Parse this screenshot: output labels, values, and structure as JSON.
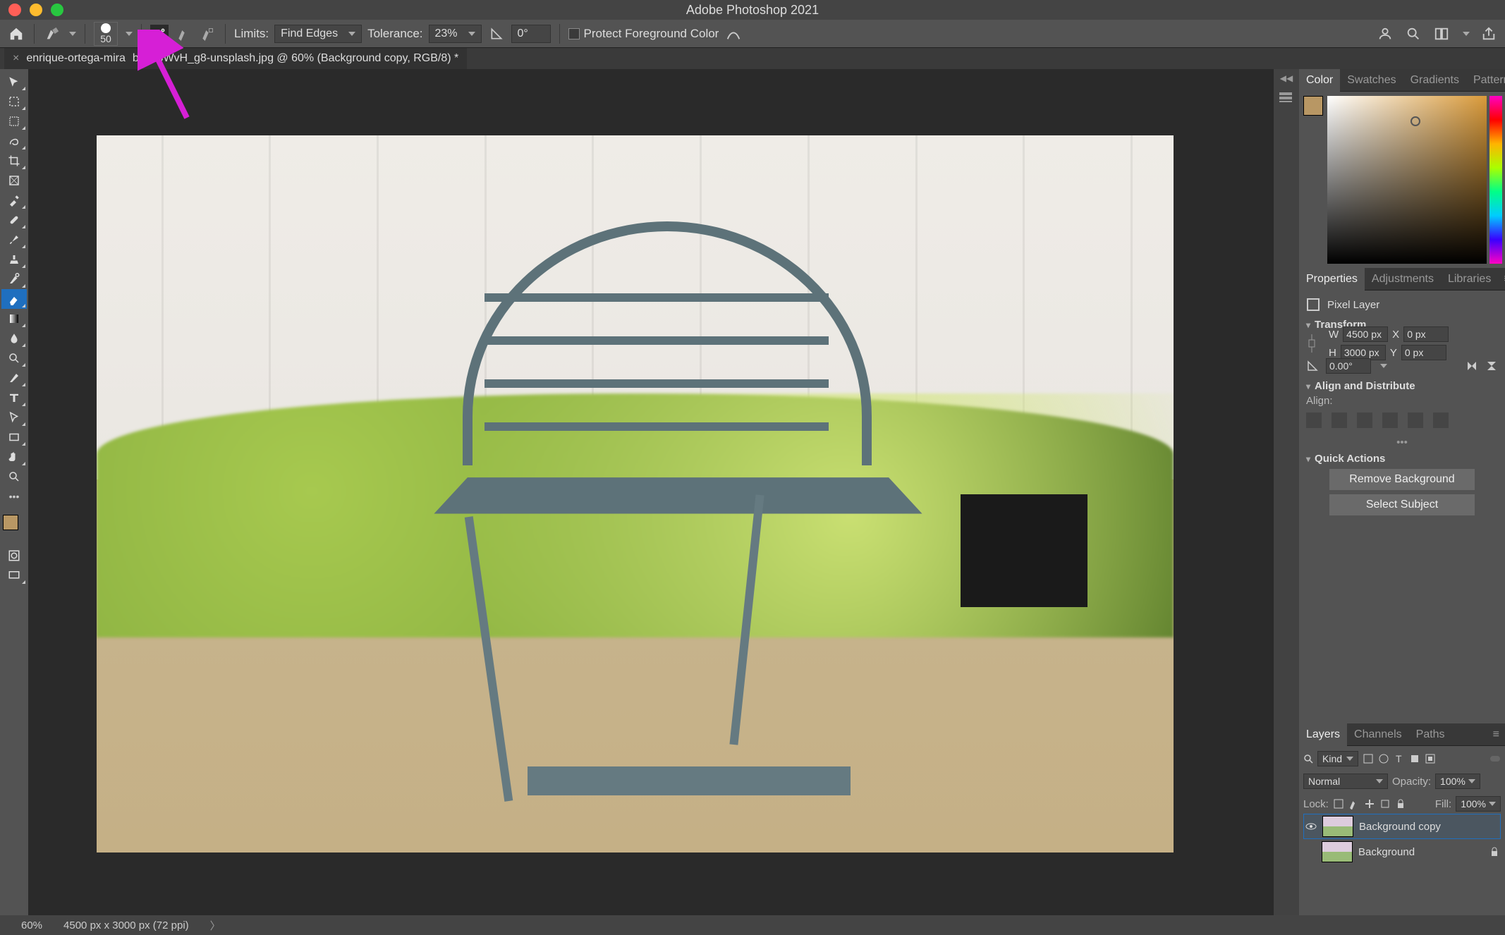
{
  "titlebar": {
    "app_title": "Adobe Photoshop 2021"
  },
  "optbar": {
    "brush_size": "50",
    "limits_label": "Limits:",
    "limits_value": "Find Edges",
    "tolerance_label": "Tolerance:",
    "tolerance_value": "23%",
    "angle_value": "0°",
    "protect_label": "Protect Foreground Color"
  },
  "doctab": {
    "filename": "enrique-ortega-mira",
    "suffix": "b3xo3WvH_g8-unsplash.jpg @ 60% (Background copy, RGB/8) *"
  },
  "toolbar": {
    "tools": [
      "move-tool",
      "artboard-tool",
      "marquee-tool",
      "lasso-tool",
      "crop-tool",
      "frame-tool",
      "eyedropper-tool",
      "spot-heal-tool",
      "brush-tool",
      "clone-stamp-tool",
      "history-brush-tool",
      "background-eraser-tool",
      "gradient-tool",
      "blur-tool",
      "dodge-tool",
      "pen-tool",
      "type-tool",
      "path-select-tool",
      "rectangle-tool",
      "hand-tool",
      "zoom-tool",
      "edit-toolbar"
    ],
    "fg_color": "#b89764",
    "bg_color": "#ffffff"
  },
  "panels": {
    "color_tabs": [
      "Color",
      "Swatches",
      "Gradients",
      "Patterns"
    ],
    "mid_tabs": [
      "Properties",
      "Adjustments",
      "Libraries"
    ],
    "bottom_tabs": [
      "Layers",
      "Channels",
      "Paths"
    ]
  },
  "properties": {
    "header": "Pixel Layer",
    "transform_section": "Transform",
    "w_label": "W",
    "w_value": "4500 px",
    "h_label": "H",
    "h_value": "3000 px",
    "x_label": "X",
    "x_value": "0 px",
    "y_label": "Y",
    "y_value": "0 px",
    "angle_value": "0.00°",
    "align_section": "Align and Distribute",
    "align_label": "Align:",
    "qa_section": "Quick Actions",
    "qa_btn1": "Remove Background",
    "qa_btn2": "Select Subject"
  },
  "layers": {
    "kind_label": "Kind",
    "blend_mode": "Normal",
    "opacity_label": "Opacity:",
    "opacity_value": "100%",
    "lock_label": "Lock:",
    "fill_label": "Fill:",
    "fill_value": "100%",
    "items": [
      {
        "name": "Background copy",
        "visible": true,
        "active": true,
        "locked": false
      },
      {
        "name": "Background",
        "visible": false,
        "active": false,
        "locked": true
      }
    ]
  },
  "statusbar": {
    "zoom": "60%",
    "dims": "4500 px x 3000 px (72 ppi)"
  },
  "accent_color": "#d61fd6"
}
